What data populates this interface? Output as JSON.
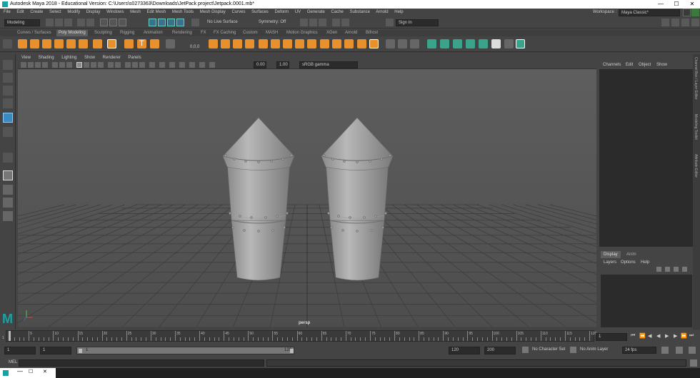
{
  "window": {
    "title": "Autodesk Maya 2018 - Educational Version: C:\\Users\\s0273363\\Downloads\\JetPack project\\Jetpack.0001.mb*",
    "controls": [
      "—",
      "☐",
      "✕"
    ]
  },
  "menubar": [
    "File",
    "Edit",
    "Create",
    "Select",
    "Modify",
    "Display",
    "Windows",
    "Mesh",
    "Edit Mesh",
    "Mesh Tools",
    "Mesh Display",
    "Curves",
    "Surfaces",
    "Deform",
    "UV",
    "Generate",
    "Cache",
    "Substance",
    "Arnold",
    "Help"
  ],
  "workspace": {
    "label": "Workspace :",
    "value": "Maya Classic*"
  },
  "statusline": {
    "menuset": "Modeling",
    "live_surface": "No Live Surface",
    "symmetry": "Symmetry: Off",
    "sign_in": "Sign In"
  },
  "shelf_tabs": [
    "Curves / Surfaces",
    "Poly Modeling",
    "Sculpting",
    "Rigging",
    "Animation",
    "Rendering",
    "FX",
    "FX Caching",
    "Custom",
    "MASH",
    "Motion Graphics",
    "XGen",
    "Arnold",
    "Bifrost"
  ],
  "active_shelf": "Poly Modeling",
  "shelf_number": "0,0,0",
  "panel_menu": [
    "View",
    "Shading",
    "Lighting",
    "Show",
    "Renderer",
    "Panels"
  ],
  "panel_toolbar": {
    "exposure": "0.00",
    "gamma": "1.00",
    "colorspace": "sRGB gamma"
  },
  "viewport": {
    "camera": "persp"
  },
  "channel_box": {
    "menu": [
      "Channels",
      "Edit",
      "Object",
      "Show"
    ]
  },
  "layer_editor": {
    "tabs": [
      "Display",
      "Anim"
    ],
    "menu": [
      "Layers",
      "Options",
      "Help"
    ]
  },
  "side_tabs": [
    "Channel Box / Layer Editor",
    "Modeling Toolkit",
    "Attribute Editor"
  ],
  "timeline": {
    "ticks": [
      "5",
      "10",
      "15",
      "20",
      "25",
      "30",
      "35",
      "40",
      "45",
      "50",
      "55",
      "60",
      "65",
      "70",
      "75",
      "80",
      "85",
      "90",
      "95",
      "100",
      "105",
      "110",
      "115",
      "120"
    ],
    "start": "1",
    "current_frame": "1"
  },
  "range": {
    "start_field": "1",
    "start_inner": "1",
    "range_start_label": "1",
    "range_end_label": "120",
    "end_inner": "120",
    "end_field": "200",
    "character_set": "No Character Set",
    "anim_layer": "No Anim Layer",
    "fps": "24 fps"
  },
  "command_line": {
    "label": "MEL"
  },
  "colors": {
    "accent": "#17a3a5",
    "shelf_orange": "#e8902c",
    "shelf_teal": "#3aa38a",
    "ui_bg": "#444444",
    "field_bg": "#2b2b2b"
  }
}
